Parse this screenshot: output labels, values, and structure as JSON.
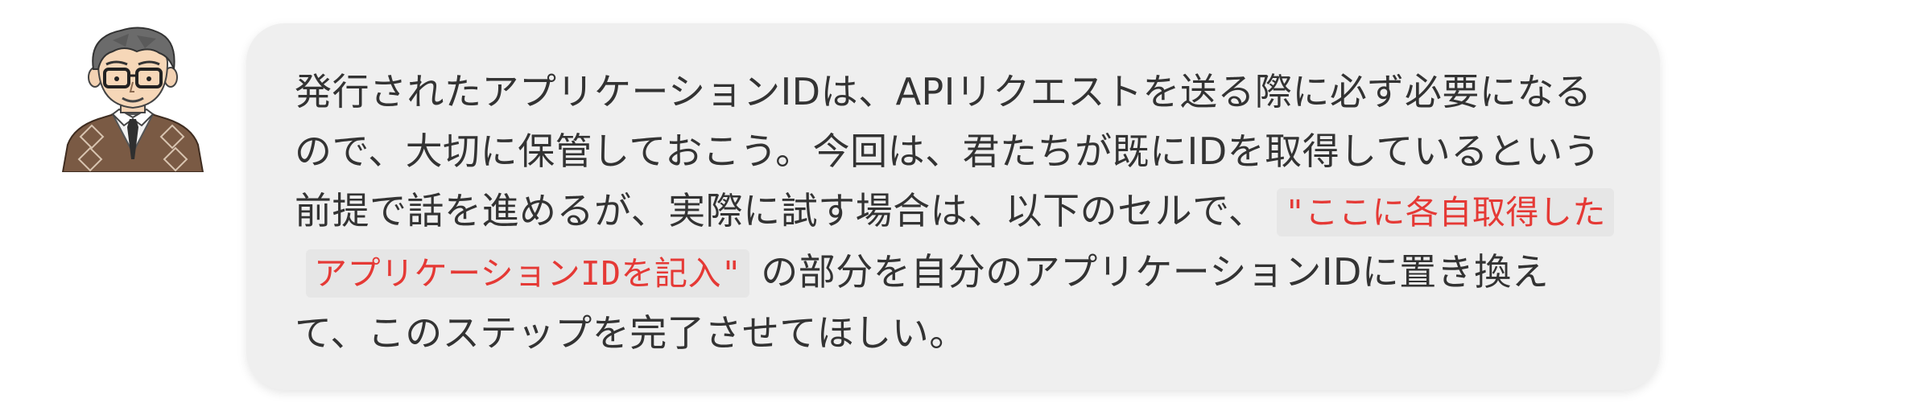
{
  "chat": {
    "avatar": {
      "icon": "teacher-avatar",
      "description": "illustrated man with glasses, sweater vest and tie"
    },
    "message": {
      "text_before": "発行されたアプリケーションIDは、APIリクエストを送る際に必ず必要になるので、大切に保管しておこう。今回は、君たちが既にIDを取得しているという前提で話を進めるが、実際に試す場合は、以下のセルで、",
      "code": "\"ここに各自取得したアプリケーションIDを記入\"",
      "text_after": "の部分を自分のアプリケーションIDに置き換えて、このステップを完了させてほしい。"
    },
    "colors": {
      "bubble_background": "#efefef",
      "text": "#333333",
      "code_text": "#e53935",
      "code_background": "#e6e6e6"
    }
  }
}
